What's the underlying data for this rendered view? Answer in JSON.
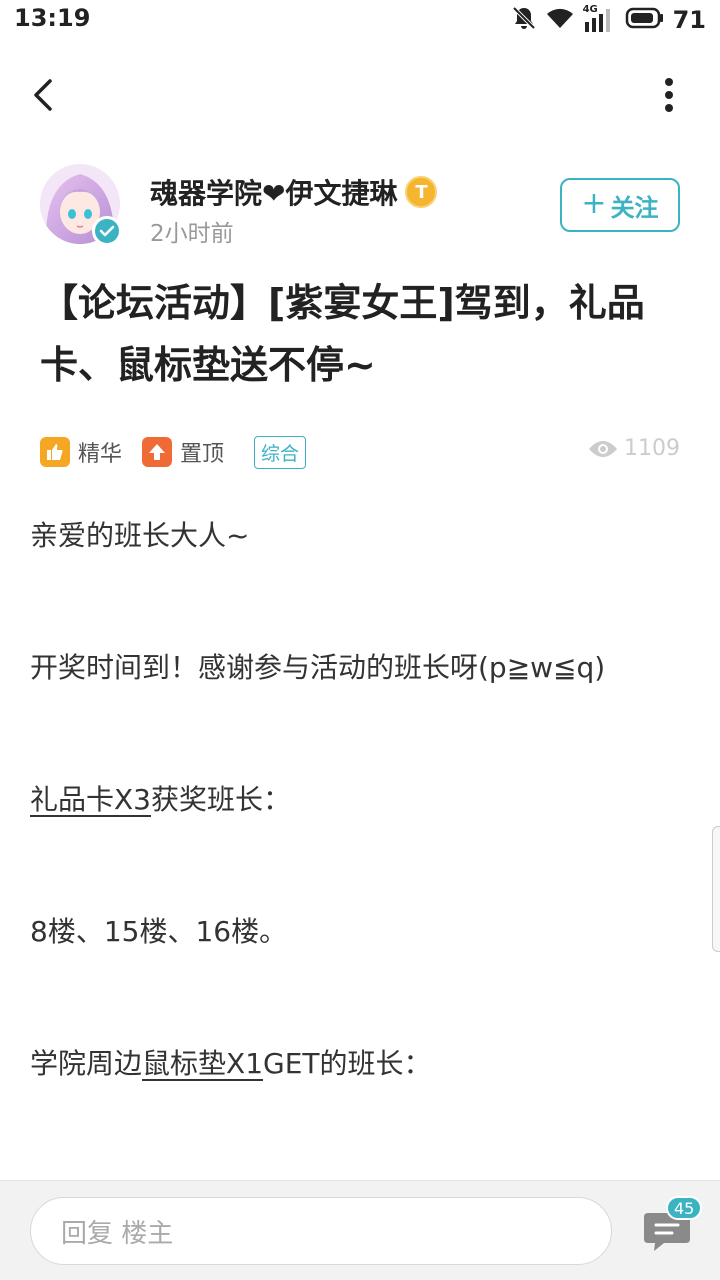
{
  "status_bar": {
    "time": "13:19",
    "network": "4G",
    "battery": "71"
  },
  "nav": {
    "back_icon": "chevron-left-icon",
    "more_icon": "more-vertical-icon"
  },
  "author": {
    "name": "魂器学院❤伊文捷琳",
    "level_badge": "T",
    "time_ago": "2小时前",
    "follow_label": "关注",
    "follow_plus": "+"
  },
  "post": {
    "title": "【论坛活动】[紫宴女王]驾到，礼品卡、鼠标垫送不停~",
    "tags": {
      "featured": "精华",
      "pinned": "置顶",
      "category": "综合"
    },
    "views": "1109",
    "body": {
      "p1": "亲爱的班长大人~",
      "p2": "开奖时间到！感谢参与活动的班长呀(p≧w≦q)",
      "p3_underlined": "礼品卡X3",
      "p3_rest": "获奖班长：",
      "p4": "8楼、15楼、16楼。",
      "p5_prefix": "学院周边",
      "p5_underlined": "鼠标垫X1",
      "p5_rest": "GET的班长："
    }
  },
  "bottom_bar": {
    "reply_placeholder": "回复  楼主",
    "comments_count": "45"
  },
  "colors": {
    "accent": "#3bb3c3",
    "featured_icon": "#f5a623",
    "pinned_icon": "#f06a35",
    "level_badge": "#f5b530"
  }
}
